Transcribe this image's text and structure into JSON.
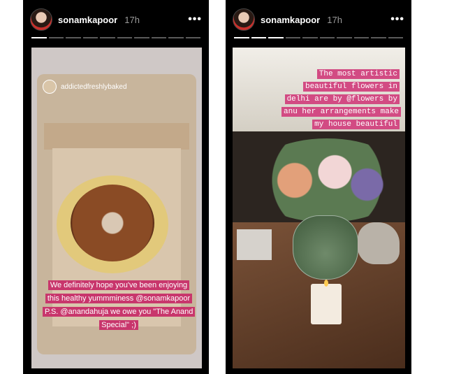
{
  "stories": {
    "left": {
      "username": "sonamkapoor",
      "time": "17h",
      "more_icon": "more-horizontal-icon",
      "repost_username": "addictedfreshlybaked",
      "caption": "We definitely hope you've been enjoying this healthy yummminess @sonamkapoor P.S. @anandahuja we owe you \"The Anand Special\" ;)"
    },
    "right": {
      "username": "sonamkapoor",
      "time": "17h",
      "more_icon": "more-horizontal-icon",
      "caption": "The most artistic beautiful flowers in delhi are by @flowers by anu her arrangements make my house beautiful"
    }
  },
  "colors": {
    "caption_left_bg": "#c8366c",
    "caption_right_bg": "#d24b83",
    "progress_active": "#ffffff",
    "progress_inactive": "#5a5a5a"
  }
}
